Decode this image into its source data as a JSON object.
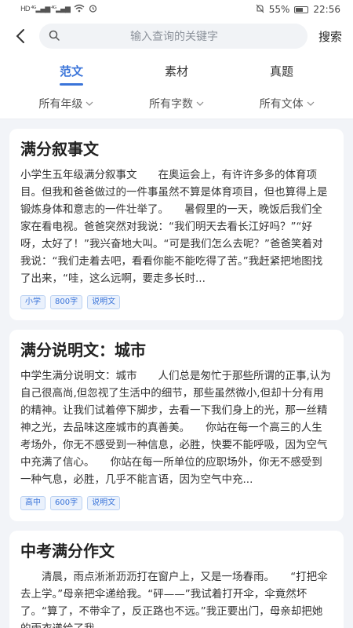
{
  "status": {
    "left": "HD 4G 4G",
    "battery": "55%",
    "time": "22:56"
  },
  "search": {
    "placeholder": "输入查询的关键字",
    "button": "搜索"
  },
  "tabs": [
    {
      "label": "范文",
      "active": true
    },
    {
      "label": "素材",
      "active": false
    },
    {
      "label": "真题",
      "active": false
    }
  ],
  "filters": [
    {
      "label": "所有年级"
    },
    {
      "label": "所有字数"
    },
    {
      "label": "所有文体"
    }
  ],
  "cards": [
    {
      "title": "满分叙事文",
      "body": "小学生五年级满分叙事文　　在奥运会上，有许许多多的体育项目。但我和爸爸做过的一件事虽然不算是体育项目，但也算得上是锻炼身体和意志的一件壮举了。　　暑假里的一天，晚饭后我们全家在看电视。爸爸突然对我说：“我们明天去看长江好吗？”“好呀，太好了！”我兴奋地大叫。“可是我们怎么去呢？”爸爸笑着对我说：“我们走着去吧，看看你能不能吃得了苦。”我赶紧把地图找了出来，“哇，这么远啊，要走多长时...",
      "tags": [
        "小学",
        "800字",
        "说明文"
      ]
    },
    {
      "title": "满分说明文：城市",
      "body": "中学生满分说明文：城市　　人们总是匆忙于那些所谓的正事,认为自己很高尚,但忽视了生活中的细节，那些虽然微小,但却十分有用的精神。让我们试着停下脚步，去看一下我们身上的光，那一丝精神之光，去品味这座城市的真善美。　　你站在每一个高三的人生考场外，你无不感受到一种信息，必胜，快要不能呼吸，因为空气中充满了信心。　　你站在每一所单位的应职场外，你无不感受到一种气息，必胜，几乎不能言语，因为空气中充...",
      "tags": [
        "高中",
        "600字",
        "说明文"
      ]
    },
    {
      "title": "中考满分作文",
      "body": "　　清晨，雨点淅淅沥沥打在窗户上，又是一场春雨。　　“打把伞去上学。”母亲把伞递给我。“砰——”我试着打开伞，伞竟然坏了。“算了，不带伞了，反正路也不远。”我正要出门，母亲却把她的雨衣递给了我",
      "tags": []
    }
  ]
}
